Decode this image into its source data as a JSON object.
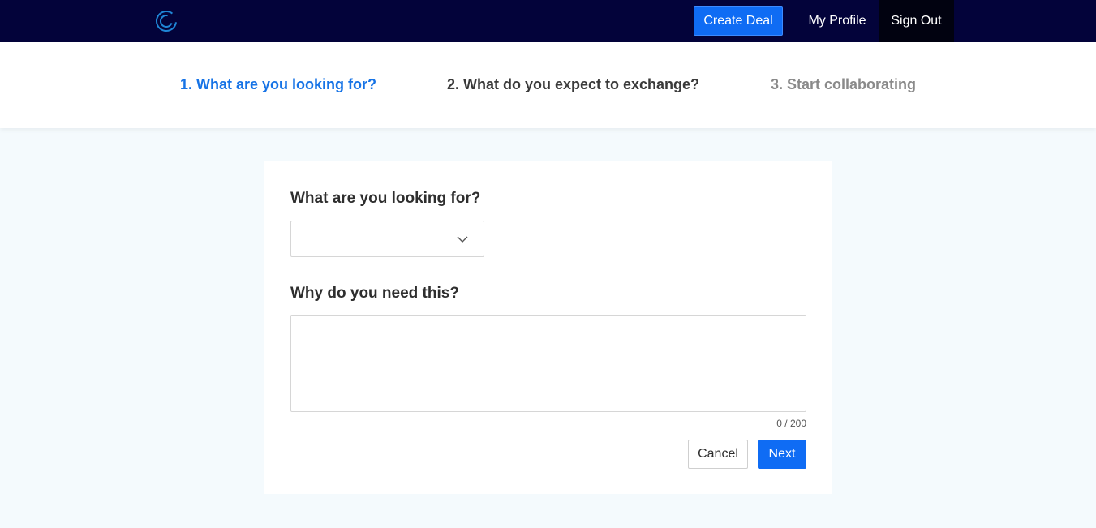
{
  "header": {
    "logo_icon": "c-logo-icon",
    "create_deal_label": "Create Deal",
    "my_profile_label": "My Profile",
    "sign_out_label": "Sign Out",
    "accent_color": "#0f6cf4",
    "bar_color": "#03033a"
  },
  "steps": [
    {
      "label": "1. What are you looking for?",
      "state": "active"
    },
    {
      "label": "2. What do you expect to exchange?",
      "state": "upcoming"
    },
    {
      "label": "3. Start collaborating",
      "state": "disabled"
    }
  ],
  "form": {
    "looking_for_label": "What are you looking for?",
    "looking_for_value": "",
    "select_icon": "chevron-down-icon",
    "need_label": "Why do you need this?",
    "need_value": "",
    "char_counter": "0 / 200",
    "cancel_label": "Cancel",
    "next_label": "Next"
  }
}
